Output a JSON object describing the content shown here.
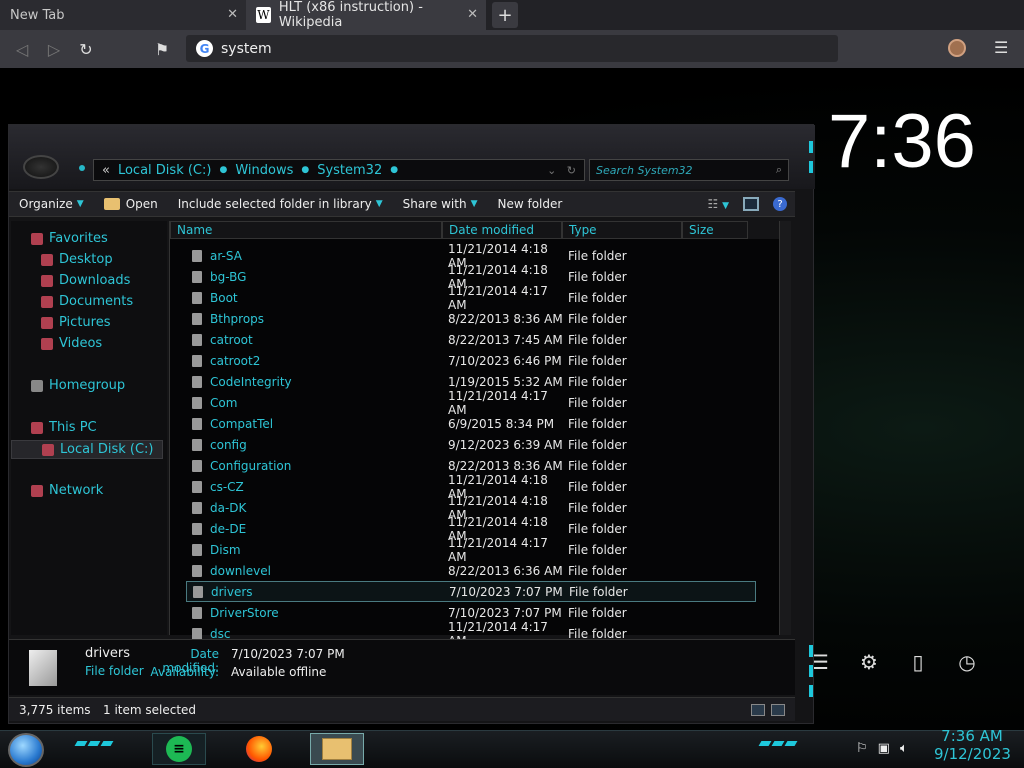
{
  "browser": {
    "tabs": [
      {
        "label": "New Tab"
      },
      {
        "label": "HLT (x86 instruction) - Wikipedia"
      }
    ],
    "url": "system"
  },
  "desktop": {
    "clock": "7:36"
  },
  "explorer": {
    "breadcrumb": {
      "prefix": "«",
      "parts": [
        "Local Disk (C:)",
        "Windows",
        "System32"
      ]
    },
    "search_placeholder": "Search System32",
    "commands": {
      "organize": "Organize",
      "open": "Open",
      "include": "Include selected folder in library",
      "share": "Share with",
      "new_folder": "New folder"
    },
    "nav": {
      "favorites": "Favorites",
      "desktop": "Desktop",
      "downloads": "Downloads",
      "documents": "Documents",
      "pictures": "Pictures",
      "videos": "Videos",
      "homegroup": "Homegroup",
      "this_pc": "This PC",
      "local_disk": "Local Disk (C:)",
      "network": "Network"
    },
    "columns": {
      "name": "Name",
      "date": "Date modified",
      "type": "Type",
      "size": "Size"
    },
    "rows": [
      {
        "name": "ar-SA",
        "date": "11/21/2014 4:18 AM",
        "type": "File folder"
      },
      {
        "name": "bg-BG",
        "date": "11/21/2014 4:18 AM",
        "type": "File folder"
      },
      {
        "name": "Boot",
        "date": "11/21/2014 4:17 AM",
        "type": "File folder"
      },
      {
        "name": "Bthprops",
        "date": "8/22/2013 8:36 AM",
        "type": "File folder"
      },
      {
        "name": "catroot",
        "date": "8/22/2013 7:45 AM",
        "type": "File folder"
      },
      {
        "name": "catroot2",
        "date": "7/10/2023 6:46 PM",
        "type": "File folder"
      },
      {
        "name": "CodeIntegrity",
        "date": "1/19/2015 5:32 AM",
        "type": "File folder"
      },
      {
        "name": "Com",
        "date": "11/21/2014 4:17 AM",
        "type": "File folder"
      },
      {
        "name": "CompatTel",
        "date": "6/9/2015 8:34 PM",
        "type": "File folder"
      },
      {
        "name": "config",
        "date": "9/12/2023 6:39 AM",
        "type": "File folder"
      },
      {
        "name": "Configuration",
        "date": "8/22/2013 8:36 AM",
        "type": "File folder"
      },
      {
        "name": "cs-CZ",
        "date": "11/21/2014 4:18 AM",
        "type": "File folder"
      },
      {
        "name": "da-DK",
        "date": "11/21/2014 4:18 AM",
        "type": "File folder"
      },
      {
        "name": "de-DE",
        "date": "11/21/2014 4:18 AM",
        "type": "File folder"
      },
      {
        "name": "Dism",
        "date": "11/21/2014 4:17 AM",
        "type": "File folder"
      },
      {
        "name": "downlevel",
        "date": "8/22/2013 6:36 AM",
        "type": "File folder"
      },
      {
        "name": "drivers",
        "date": "7/10/2023 7:07 PM",
        "type": "File folder"
      },
      {
        "name": "DriverStore",
        "date": "7/10/2023 7:07 PM",
        "type": "File folder"
      },
      {
        "name": "dsc",
        "date": "11/21/2014 4:17 AM",
        "type": "File folder"
      }
    ],
    "details": {
      "name": "drivers",
      "type": "File folder",
      "date_label": "Date modified:",
      "date_value": "7/10/2023 7:07 PM",
      "avail_label": "Availability:",
      "avail_value": "Available offline"
    },
    "status": {
      "items": "3,775 items",
      "selected": "1 item selected"
    }
  },
  "taskbar": {
    "time": "7:36 AM",
    "date": "9/12/2023"
  }
}
